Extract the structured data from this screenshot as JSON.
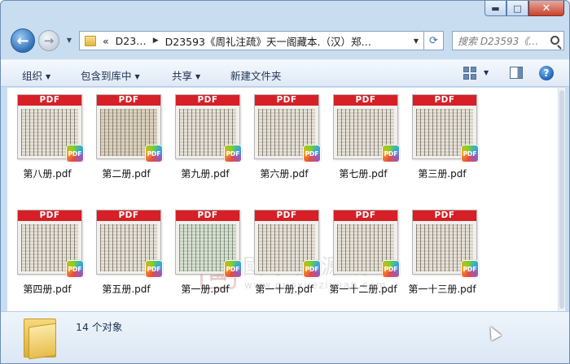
{
  "window": {
    "caption_buttons": {
      "minimize": "▬",
      "maximize": "□",
      "close": "✕"
    }
  },
  "navigation": {
    "back_arrow": "←",
    "forward_arrow": "→",
    "address": {
      "overflow": "«",
      "crumb1": "D23…",
      "crumb2": "D23593《周礼注疏》天一阁藏本.（汉）郑…"
    },
    "refresh": "⟳",
    "search_placeholder": "搜索 D23593《…"
  },
  "toolbar": {
    "organize": "组织",
    "include_library": "包含到库中",
    "share": "共享",
    "new_folder": "新建文件夹"
  },
  "files": [
    {
      "name": "第八册.pdf",
      "thumb": "PDF",
      "tone": "plain"
    },
    {
      "name": "第二册.pdf",
      "thumb": "PDF",
      "tone": "tint"
    },
    {
      "name": "第九册.pdf",
      "thumb": "PDF",
      "tone": "plain"
    },
    {
      "name": "第六册.pdf",
      "thumb": "PDF",
      "tone": "plain"
    },
    {
      "name": "第七册.pdf",
      "thumb": "PDF",
      "tone": "plain"
    },
    {
      "name": "第三册.pdf",
      "thumb": "PDF",
      "tone": "plain"
    },
    {
      "name": "第四册.pdf",
      "thumb": "PDF",
      "tone": "plain"
    },
    {
      "name": "第五册.pdf",
      "thumb": "PDF",
      "tone": "plain"
    },
    {
      "name": "第一册.pdf",
      "thumb": "PDF",
      "tone": "green"
    },
    {
      "name": "第一十册.pdf",
      "thumb": "PDF",
      "tone": "plain"
    },
    {
      "name": "第一十二册.pdf",
      "thumb": "PDF",
      "tone": "plain"
    },
    {
      "name": "第一十三册.pdf",
      "thumb": "PDF",
      "tone": "plain"
    }
  ],
  "badge_text": "PDF",
  "watermark": {
    "seal": "國",
    "title": "國學資源網",
    "url": "www.guoxueziyuan.com"
  },
  "details": {
    "count": "14 个对象"
  },
  "icons": {
    "help": "?",
    "dropdown": "▼",
    "chevron": "▶"
  }
}
